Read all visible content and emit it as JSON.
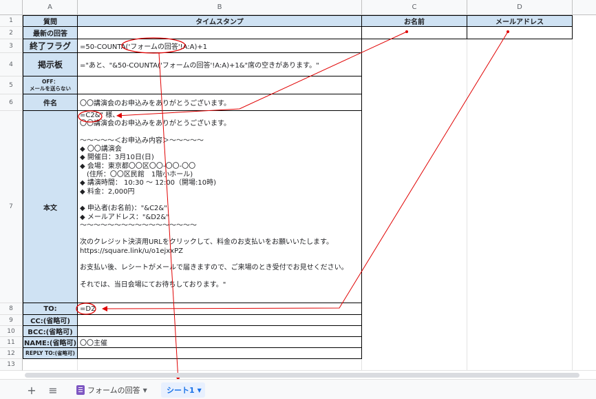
{
  "columns": [
    "A",
    "B",
    "C",
    "D"
  ],
  "rows": [
    "1",
    "2",
    "3",
    "4",
    "5",
    "6",
    "7",
    "8",
    "9",
    "10",
    "11",
    "12",
    "13"
  ],
  "cells": {
    "a1": "質問",
    "b1": "タイムスタンプ",
    "c1": "お名前",
    "d1": "メールアドレス",
    "a2": "最新の回答",
    "a3": "終了フラグ",
    "b3": "=50-COUNTA('フォームの回答'!A:A)+1",
    "a4": "掲示板",
    "b4": "=\"あと、\"&50-COUNTA('フォームの回答'!A:A)+1&\"席の空きがあります。\"",
    "a5": "OFF：\nメールを送らない",
    "a6": "件名",
    "b6": "〇〇講演会のお申込みをありがとうございます。",
    "a7": "本文",
    "b7": "=C2&\" 様、\n〇〇講演会のお申込みをありがとうございます。\n\n〜〜〜〜〜＜お申込み内容＞〜〜〜〜〜\n◆ 〇〇講演会\n◆ 開催日：3月10日(日)\n◆ 会場：東京都〇〇区〇〇-〇〇-〇〇\n　(住所：〇〇区民館　1階小ホール)\n◆ 講演時間： 10:30 〜 12:00（開場:10時)\n◆ 料金：2,000円\n\n◆ 申込者(お名前)：\"&C2&\"\n◆ メールアドレス：\"&D2&\"\n〜〜〜〜〜〜〜〜〜〜〜〜〜〜〜〜〜\n\n次のクレジット決済用URLをクリックして、料金のお支払いをお願いいたします。\nhttps://square.link/u/o1ejxxPZ\n\nお支払い後、レシートがメールで届きますので、ご来場のとき受付でお見せください。\n\nそれでは、当日会場にてお待ちしております。\"",
    "a8": "TO:",
    "b8": "=D2",
    "a9": "CC:(省略可)",
    "a10": "BCC:(省略可)",
    "a11": "NAME:(省略可)",
    "b11": "〇〇主催",
    "a12": "REPLY TO:(省略可)"
  },
  "tabs": {
    "add_sheet_icon": "plus-icon",
    "all_sheets_icon": "menu-icon",
    "sheet1_label": "フォームの回答",
    "sheet2_label": "シート1"
  },
  "colors": {
    "label_fill": "#cfe2f3",
    "annotation": "#e00000",
    "active_tab": "#1a73e8"
  }
}
